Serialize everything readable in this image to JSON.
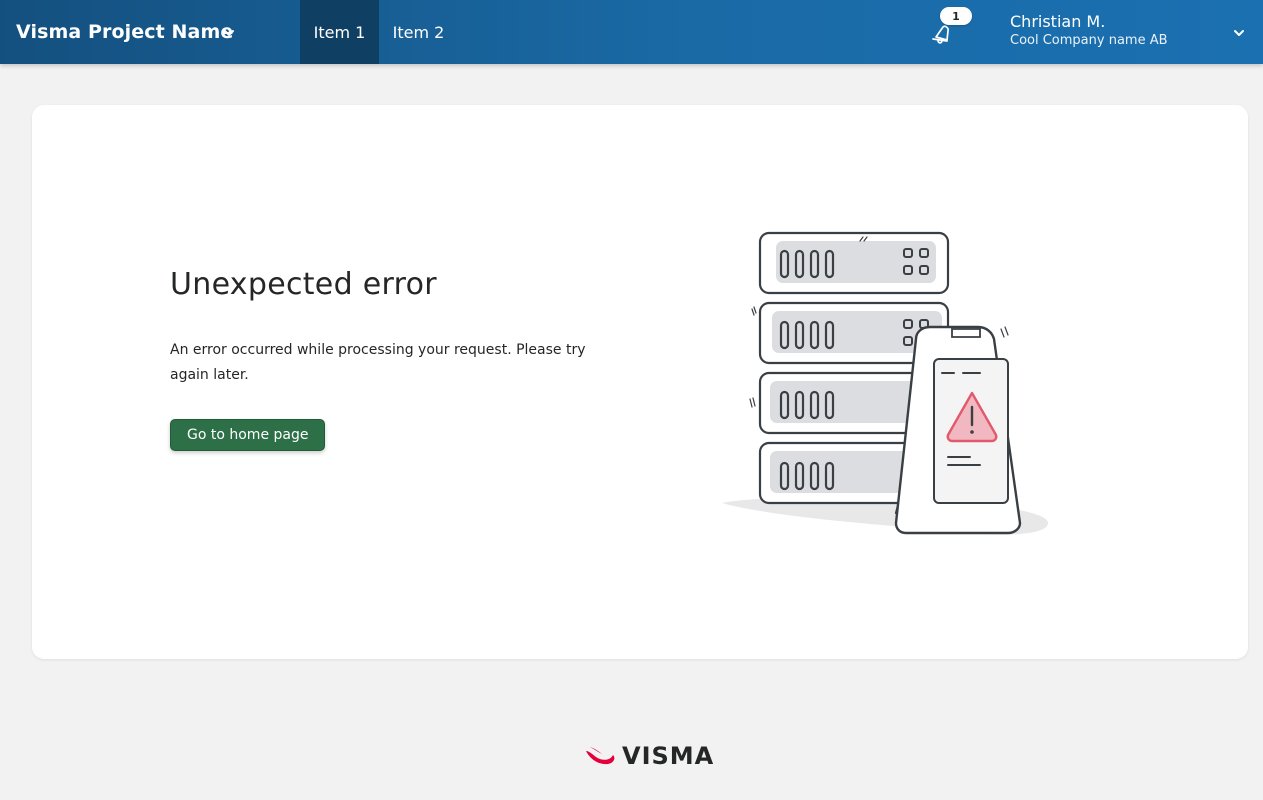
{
  "header": {
    "brand": "Visma Project Name",
    "nav_items": [
      {
        "label": "Item 1",
        "active": true
      },
      {
        "label": "Item 2",
        "active": false
      }
    ],
    "notifications": {
      "count": "1",
      "icon": "bell-icon"
    },
    "user": {
      "name": "Christian M.",
      "company": "Cool Company name AB"
    }
  },
  "main": {
    "title": "Unexpected error",
    "message": "An error occurred while processing your request. Please try again later.",
    "home_button_label": "Go to home page",
    "illustration": "server-error-illustration"
  },
  "footer": {
    "logo_text": "VISMA"
  },
  "colors": {
    "navbar_start": "#14507f",
    "navbar_end": "#1b70b1",
    "nav_active": "#103f64",
    "primary_button": "#2d7048",
    "brand_red": "#e4003a",
    "warning_red": "#e05a6b",
    "page_background": "#f2f2f2"
  }
}
